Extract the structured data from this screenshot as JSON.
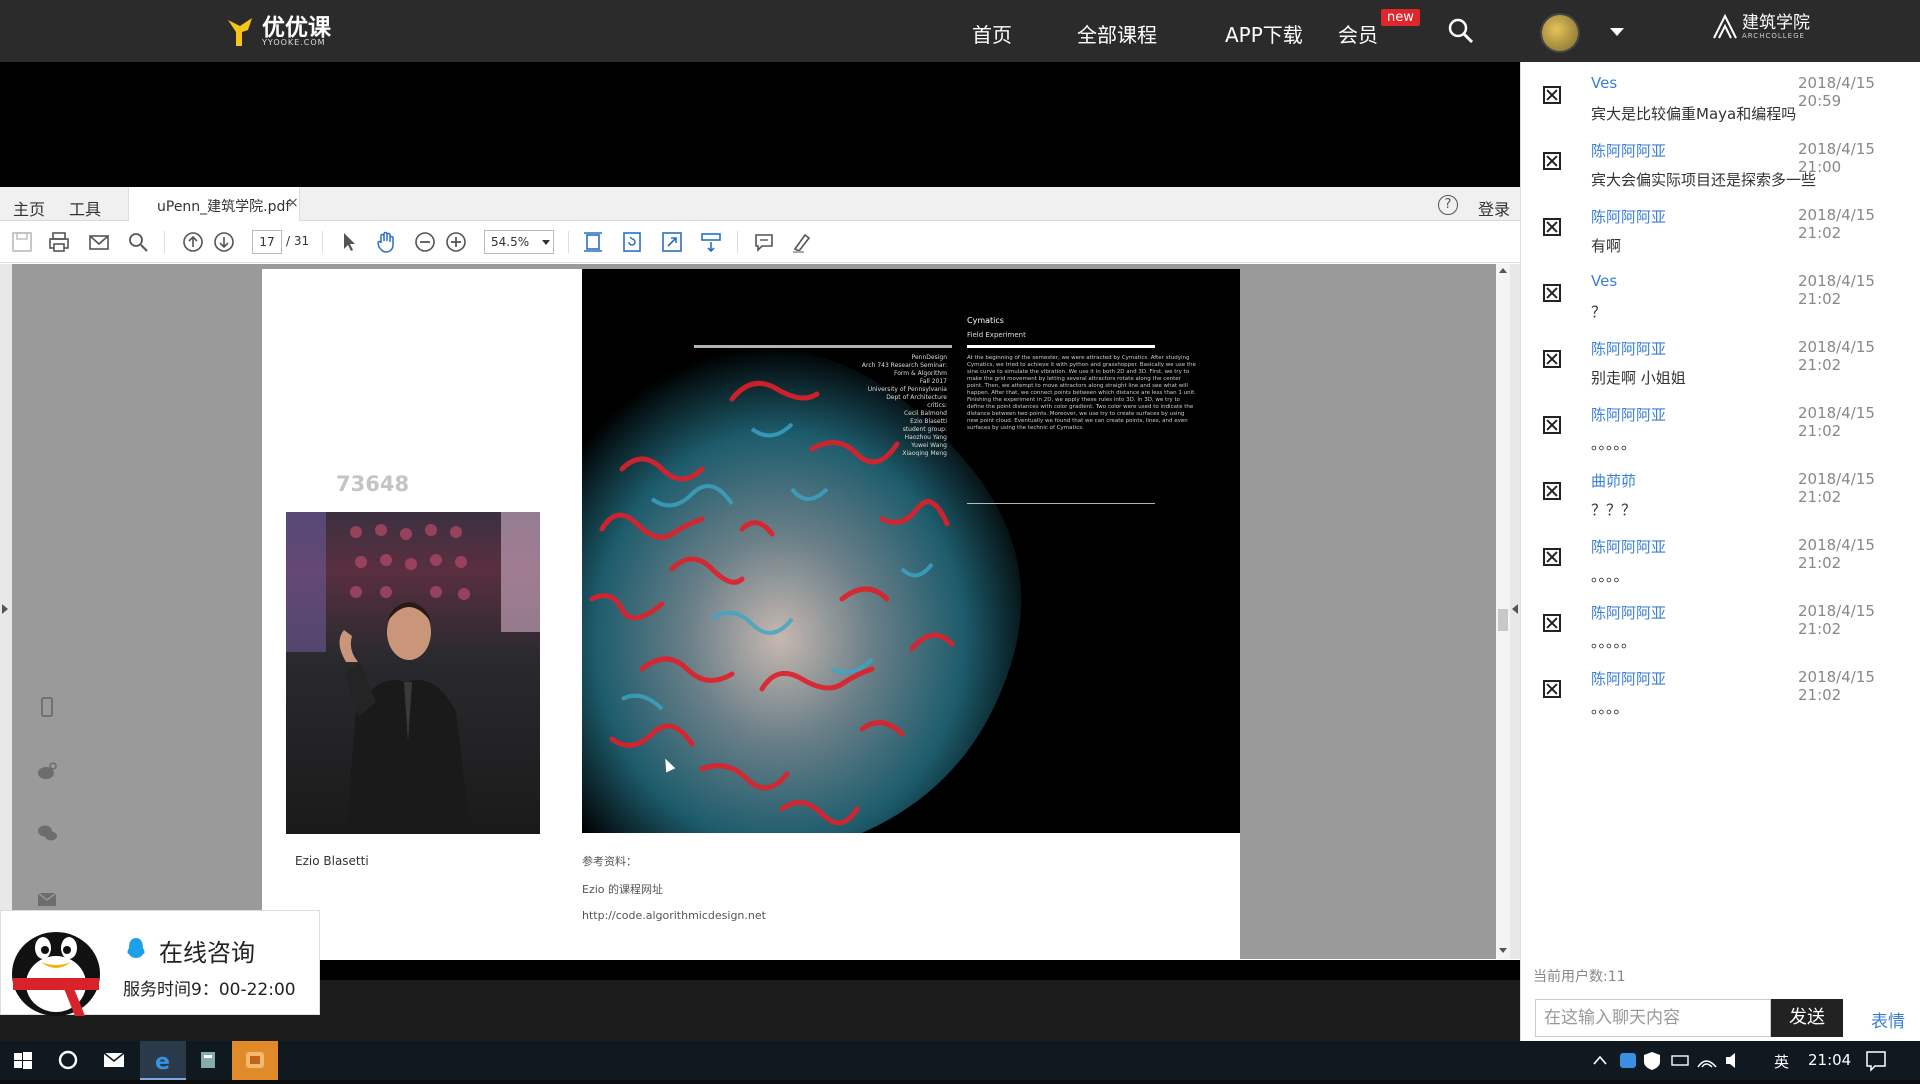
{
  "topnav": {
    "logo_text": "优优课",
    "logo_sub": "YYOOKE.COM",
    "items": [
      {
        "label": "首页"
      },
      {
        "label": "全部课程"
      },
      {
        "label": "APP下载"
      },
      {
        "label": "会员"
      }
    ],
    "new_badge": "new",
    "brand_name": "建筑学院",
    "brand_sub": "ARCHCOLLEGE"
  },
  "pdf": {
    "menu_home": "主页",
    "menu_tools": "工具",
    "tab_title": "uPenn_建筑学院.pdf",
    "tab_close": "×",
    "login": "登录",
    "help": "?",
    "current_page": "17",
    "total_pages": "/ 31",
    "zoom": "54.5%",
    "page_number_overlay": "73648",
    "portrait_name": "Ezio Blasetti",
    "art_heading": "Cymatics",
    "art_sub": "Field Experiment",
    "art_credits": "PennDesign\nArch 743 Research Seminar:\nForm & Algorithm\nFall 2017\nUniversity of Pennsylvania\nDept of Architecture\ncritics:\nCecil Balmond\nEzio Blasetti\nstudent group:\nHaozhou Yang\nYuwei Wang\nXiaoqing Meng",
    "art_body": "At the beginning of the semester, we were attracted by Cymatics. After studying Cymatics, we tried to achieve it with python and grasshopper. Basically we use the sine curve to simulate the vibration. We use it in both 2D and 3D. First, we try to make the grid movement by letting several attractors rotate along the center point. Then, we attempt to move attractors along straight line and see what will happen. After that, we connect points between which distance are less than 1 unit. Finishing the experiment in 2D, we apply these rules into 3D. In 3D, we try to define the point distances with color gradient. Two color were used to indicate the distance between two points. Moreover, we use try to create surfaces by using new point cloud. Eventually we found that we can create points, lines, and even surfaces by using the technic of Cymatics.",
    "ref_label": "参考资料：",
    "ref_name": "Ezio 的课程网址",
    "ref_url": "http://code.algorithmicdesign.net"
  },
  "consult": {
    "title": "在线咨询",
    "hours": "服务时间9：00-22:00"
  },
  "chat": {
    "messages": [
      {
        "name": "Ves",
        "time": "2018/4/15 20:59",
        "text": "宾大是比较偏重Maya和编程吗"
      },
      {
        "name": "陈阿阿阿亚",
        "time": "2018/4/15 21:00",
        "text": "宾大会偏实际项目还是探索多一些"
      },
      {
        "name": "陈阿阿阿亚",
        "time": "2018/4/15 21:02",
        "text": "有啊"
      },
      {
        "name": "Ves",
        "time": "2018/4/15 21:02",
        "text": "？"
      },
      {
        "name": "陈阿阿阿亚",
        "time": "2018/4/15 21:02",
        "text": "别走啊 小姐姐"
      },
      {
        "name": "陈阿阿阿亚",
        "time": "2018/4/15 21:02",
        "text": "。。。。。"
      },
      {
        "name": "曲茆茆",
        "time": "2018/4/15 21:02",
        "text": "？？？"
      },
      {
        "name": "陈阿阿阿亚",
        "time": "2018/4/15 21:02",
        "text": "。。。。"
      },
      {
        "name": "陈阿阿阿亚",
        "time": "2018/4/15 21:02",
        "text": "。。。。。"
      },
      {
        "name": "陈阿阿阿亚",
        "time": "2018/4/15 21:02",
        "text": "。。。。"
      }
    ],
    "user_count": "当前用户数:11",
    "input_placeholder": "在这输入聊天内容",
    "send": "发送",
    "emoji": "表情"
  },
  "taskbar": {
    "lang": "英",
    "clock": "21:04"
  },
  "colors": {
    "accent_blue": "#3a7fd5",
    "new_badge": "#e0262d",
    "topnav_bg": "#2b2b2b"
  }
}
